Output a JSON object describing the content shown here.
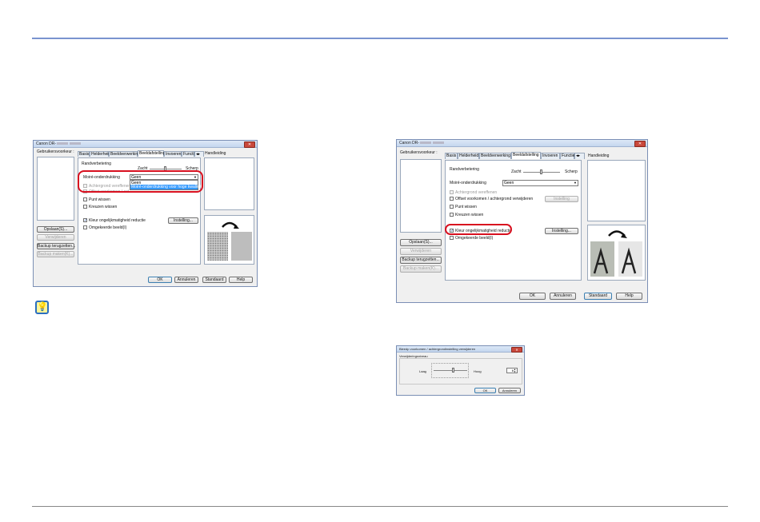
{
  "dialog1": {
    "title": "Canon DR-",
    "image_source_label": "Gebruikersvoorkeur :",
    "tabs": [
      "Basis",
      "Helderheid",
      "Beeldverwerking",
      "Beeldafstelling",
      "Invoeren",
      "Functi"
    ],
    "active_tab": "Beeldafstelling",
    "manual_label": "Handleiding",
    "edge_label": "Randverbetering",
    "slider_low": "Zacht",
    "slider_high": "Scherp",
    "moire_label": "Moiré-onderdrukking",
    "moire_value": "Geen",
    "moire_options": [
      "Geen",
      "Moiré-onderdrukking voor hoge kwaliteit"
    ],
    "bg_smooth": "Achtergrond vereffenen",
    "offset_label": "Offset voorkomen / achtergrond verwijderen",
    "dot_remove": "Punt wissen",
    "notch_remove": "Kreuzen wissen",
    "color_label": "Kleur ongelijkmatigheid reductie",
    "inverse_label": "Omgekeerde beeld(I)",
    "settings_button": "Instelling...",
    "save_btn": "Opslaan(S)...",
    "delete_btn": "Verwijderen",
    "backup_btn": "Backup terugzetten...",
    "backup_make_btn": "Backup maken(K)...",
    "ok": "OK",
    "cancel": "Annuleren",
    "default": "Standaard",
    "help": "Help"
  },
  "dialog2": {
    "title": "Canon DR-",
    "image_source_label": "Gebruikersvoorkeur :",
    "tabs": [
      "Basis",
      "Helderheid",
      "Beeldverwerking",
      "Beeldafstelling",
      "Invoeren",
      "Functie"
    ],
    "active_tab": "Beeldafstelling",
    "manual_label": "Handleiding",
    "edge_label": "Randverbetering",
    "slider_low": "Zacht",
    "slider_high": "Scherp",
    "moire_label": "Moiré-onderdrukking",
    "moire_value": "Geen",
    "bg_smooth": "Achtergrond vereffenen",
    "offset_label": "Offset voorkomen / achtergrond verwijderen",
    "settings_button_top": "Instelling",
    "dot_remove": "Punt wissen",
    "notch_remove": "Kreuzen wissen",
    "color_label": "Kleur ongelijkmatigheid reductie",
    "settings_button": "Instelling...",
    "inverse_label": "Omgekeerde beeld(I)",
    "save_btn": "Opslaan(S)...",
    "delete_btn": "Verwijderen",
    "backup_btn": "Backup terugzetten...",
    "backup_make_btn": "Backup maken(K)...",
    "ok": "OK",
    "cancel": "Annuleren",
    "default": "Standaard",
    "help": "Help"
  },
  "dialog3": {
    "title": "Bleedp voorkomen / achtergrondinstelling verwijderen",
    "group_label": "Verwijderingsniveau",
    "low": "Laag",
    "high": "Hoog",
    "value": "6",
    "ok": "OK",
    "cancel": "Annuleren"
  },
  "tip_icon": "lightbulb-icon"
}
